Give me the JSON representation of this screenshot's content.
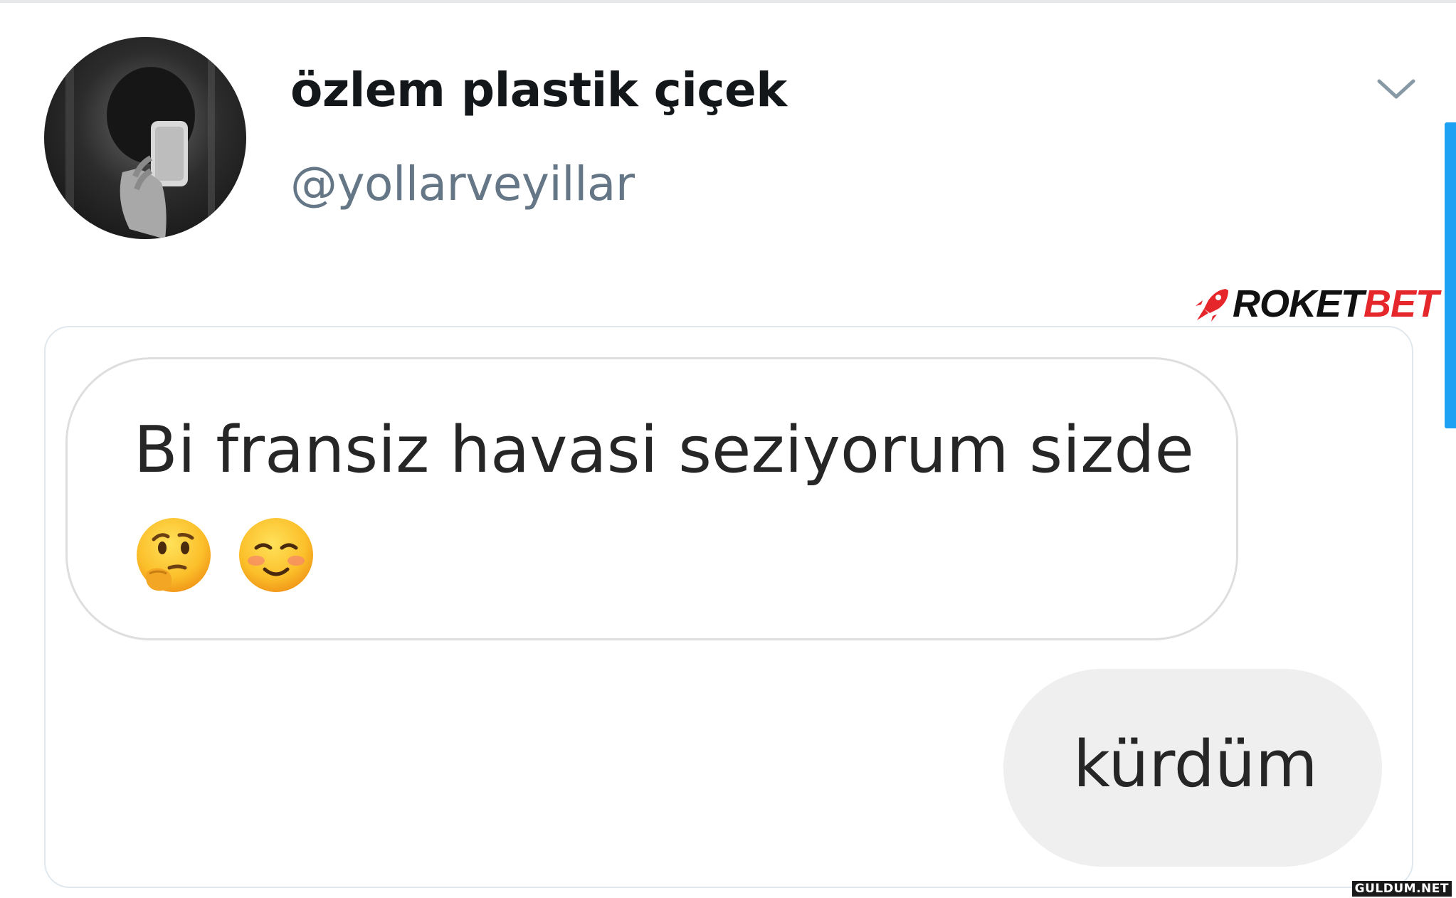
{
  "tweet": {
    "display_name": "özlem plastik çiçek",
    "handle": "@yollarveyillar"
  },
  "overlay_logo": {
    "part_a": "ROKET",
    "part_b": "BET",
    "color_a": "#111111",
    "color_b": "#e5262a",
    "icon": "rocket-icon"
  },
  "chat": {
    "incoming_message": "Bi fransiz havasi seziyorum sizde",
    "incoming_emojis": [
      "thinking-face-emoji",
      "smiling-face-emoji"
    ],
    "outgoing_message": "kürdüm"
  },
  "watermark": "GULDUM.NET",
  "colors": {
    "accent": "#1da1f2",
    "handle_gray": "#657786",
    "outgoing_bubble": "#efefef"
  }
}
